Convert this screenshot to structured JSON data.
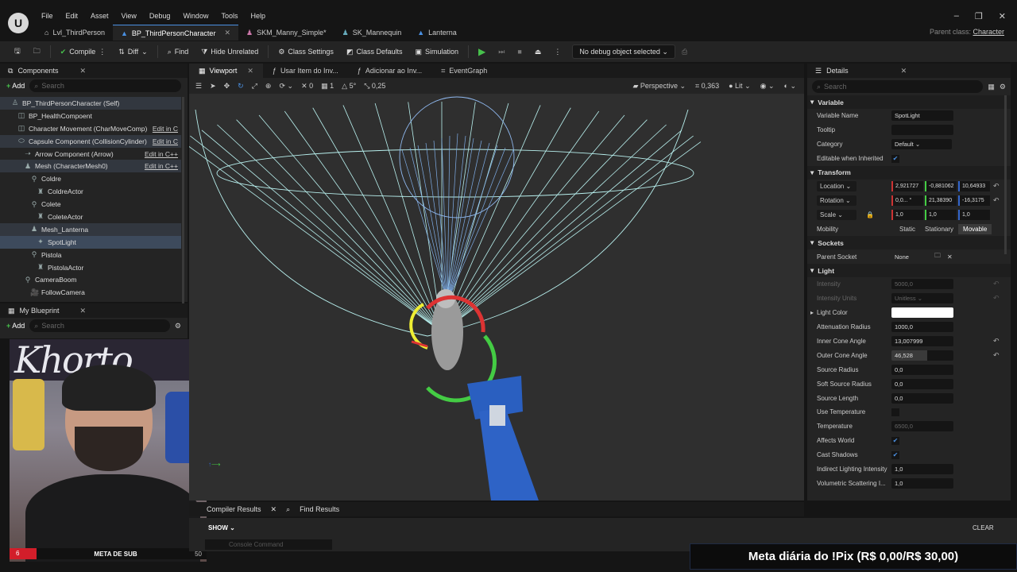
{
  "menu": [
    "File",
    "Edit",
    "Asset",
    "View",
    "Debug",
    "Window",
    "Tools",
    "Help"
  ],
  "doc_tabs": [
    {
      "label": "Lvl_ThirdPerson",
      "icon": "⌂",
      "active": false
    },
    {
      "label": "BP_ThirdPersonCharacter",
      "icon": "▲",
      "active": true
    },
    {
      "label": "SKM_Manny_Simple*",
      "icon": "♟",
      "active": false
    },
    {
      "label": "SK_Mannequin",
      "icon": "♟",
      "active": false
    },
    {
      "label": "Lanterna",
      "icon": "▲",
      "active": false
    }
  ],
  "parent_class": {
    "label": "Parent class:",
    "value": "Character"
  },
  "toolbar": {
    "compile": "Compile",
    "diff": "Diff",
    "find": "Find",
    "hide_unrelated": "Hide Unrelated",
    "class_settings": "Class Settings",
    "class_defaults": "Class Defaults",
    "simulation": "Simulation",
    "debug_object": "No debug object selected"
  },
  "components": {
    "tab": "Components",
    "add": "Add",
    "search_placeholder": "Search",
    "tree": [
      {
        "label": "BP_ThirdPersonCharacter (Self)",
        "indent": 0,
        "edit": ""
      },
      {
        "label": "BP_HealthCompoent",
        "indent": 1,
        "edit": ""
      },
      {
        "label": "Character Movement (CharMoveComp)",
        "indent": 1,
        "edit": "Edit in C"
      },
      {
        "label": "Capsule Component (CollisionCylinder)",
        "indent": 1,
        "edit": "Edit in C"
      },
      {
        "label": "Arrow Component (Arrow)",
        "indent": 2,
        "edit": "Edit in C++"
      },
      {
        "label": "Mesh (CharacterMesh0)",
        "indent": 2,
        "edit": "Edit in C++"
      },
      {
        "label": "Coldre",
        "indent": 3,
        "edit": ""
      },
      {
        "label": "ColdreActor",
        "indent": 4,
        "edit": ""
      },
      {
        "label": "Colete",
        "indent": 3,
        "edit": ""
      },
      {
        "label": "ColeteActor",
        "indent": 4,
        "edit": ""
      },
      {
        "label": "Mesh_Lanterna",
        "indent": 3,
        "edit": ""
      },
      {
        "label": "SpotLight",
        "indent": 4,
        "edit": ""
      },
      {
        "label": "Pistola",
        "indent": 3,
        "edit": ""
      },
      {
        "label": "PistolaActor",
        "indent": 4,
        "edit": ""
      },
      {
        "label": "CameraBoom",
        "indent": 2,
        "edit": ""
      },
      {
        "label": "FollowCamera",
        "indent": 3,
        "edit": ""
      }
    ]
  },
  "my_blueprint": {
    "tab": "My Blueprint",
    "add": "Add",
    "search_placeholder": "Search"
  },
  "webcam": {
    "banner": "Khorto",
    "sub_current": "6",
    "sub_label": "META DE SUB",
    "sub_goal": "50"
  },
  "viewport_tabs": [
    {
      "label": "Viewport",
      "active": true
    },
    {
      "label": "Usar Item do Inv...",
      "active": false
    },
    {
      "label": "Adicionar ao Inv...",
      "active": false
    },
    {
      "label": "EventGraph",
      "active": false
    }
  ],
  "viewport_toolbar": {
    "num1": "0",
    "num2": "1",
    "num3": "5°",
    "num4": "0,25",
    "perspective": "Perspective",
    "fov": "0,363",
    "lit": "Lit"
  },
  "bottom_tabs": [
    "Compiler Results",
    "Find Results"
  ],
  "bottom": {
    "show": "SHOW",
    "console_placeholder": "Console Command",
    "clear": "CLEAR"
  },
  "pix_overlay": "Meta diária do !Pix (R$ 0,00/R$ 30,00)",
  "details": {
    "tab": "Details",
    "search_placeholder": "Search",
    "variable_section": "Variable",
    "variable_name_label": "Variable Name",
    "variable_name": "SpotLight",
    "tooltip_label": "Tooltip",
    "category_label": "Category",
    "category": "Default",
    "editable_label": "Editable when Inherited",
    "transform_section": "Transform",
    "location_label": "Location",
    "location": [
      "2,921727",
      "-0,881062",
      "10,64933"
    ],
    "rotation_label": "Rotation",
    "rotation": [
      "0,0... °",
      "21,38390",
      "-16,3175"
    ],
    "scale_label": "Scale",
    "scale": [
      "1,0",
      "1,0",
      "1,0"
    ],
    "mobility_label": "Mobility",
    "mobility": [
      "Static",
      "Stationary",
      "Movable"
    ],
    "sockets_section": "Sockets",
    "parent_socket_label": "Parent Socket",
    "parent_socket": "None",
    "light_section": "Light",
    "intensity_label": "Intensity",
    "intensity": "5000,0",
    "intensity_units_label": "Intensity Units",
    "intensity_units": "Unitless",
    "light_color_label": "Light Color",
    "light_color": "#ffffff",
    "attenuation_label": "Attenuation Radius",
    "attenuation": "1000,0",
    "inner_cone_label": "Inner Cone Angle",
    "inner_cone": "13,007999",
    "outer_cone_label": "Outer Cone Angle",
    "outer_cone": "46,528",
    "source_radius_label": "Source Radius",
    "source_radius": "0,0",
    "soft_source_label": "Soft Source Radius",
    "soft_source": "0,0",
    "source_length_label": "Source Length",
    "source_length": "0,0",
    "use_temp_label": "Use Temperature",
    "temperature_label": "Temperature",
    "temperature": "6500,0",
    "affects_world_label": "Affects World",
    "cast_shadows_label": "Cast Shadows",
    "indirect_label": "Indirect Lighting Intensity",
    "indirect": "1,0",
    "volumetric_label": "Volumetric Scattering I...",
    "volumetric": "1,0"
  }
}
